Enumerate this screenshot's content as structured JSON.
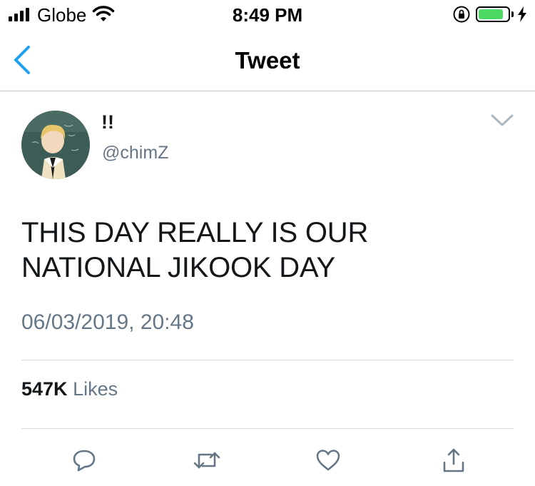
{
  "status_bar": {
    "carrier": "Globe",
    "time": "8:49 PM",
    "signal_bars": 4,
    "battery_level": 0.85,
    "battery_color": "#4cd964"
  },
  "nav": {
    "title": "Tweet",
    "back_icon": "chevron-left-icon",
    "accent": "#1da1f2"
  },
  "tweet": {
    "display_name": "!!",
    "handle": "@chimZ",
    "text": "THIS DAY REALLY IS OUR NATIONAL JIKOOK DAY",
    "timestamp": "06/03/2019, 20:48",
    "likes_count": "547K",
    "likes_label": "Likes"
  },
  "actions": [
    {
      "name": "reply",
      "icon": "comment-icon"
    },
    {
      "name": "retweet",
      "icon": "retweet-icon"
    },
    {
      "name": "like",
      "icon": "heart-icon"
    },
    {
      "name": "share",
      "icon": "share-icon"
    }
  ]
}
